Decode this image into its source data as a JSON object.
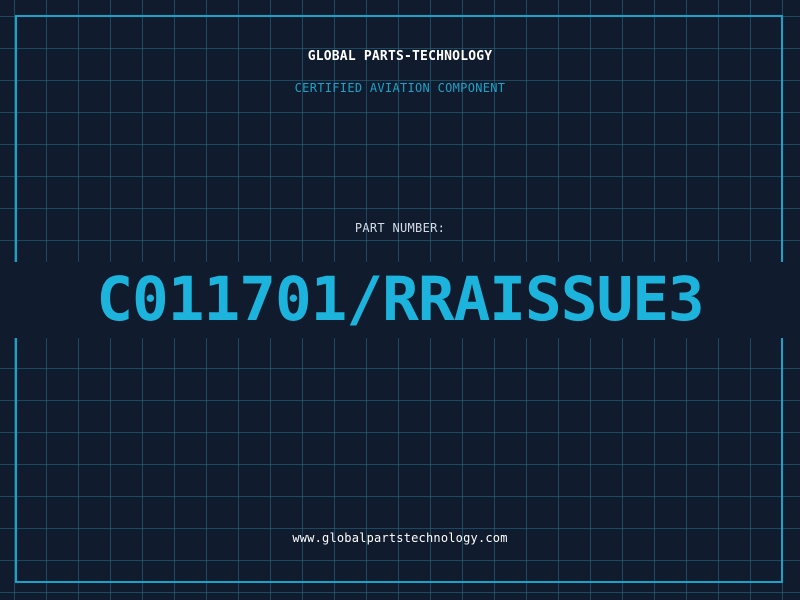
{
  "header": {
    "company_name": "GLOBAL PARTS-TECHNOLOGY",
    "subtitle": "CERTIFIED AVIATION COMPONENT"
  },
  "part": {
    "label": "PART NUMBER:",
    "number": "C011701/RRAISSUE3"
  },
  "footer": {
    "website": "www.globalpartstechnology.com"
  },
  "colors": {
    "background": "#111b2e",
    "accent": "#1aa3c9",
    "text": "#ffffff",
    "label": "#d2dbe6"
  }
}
